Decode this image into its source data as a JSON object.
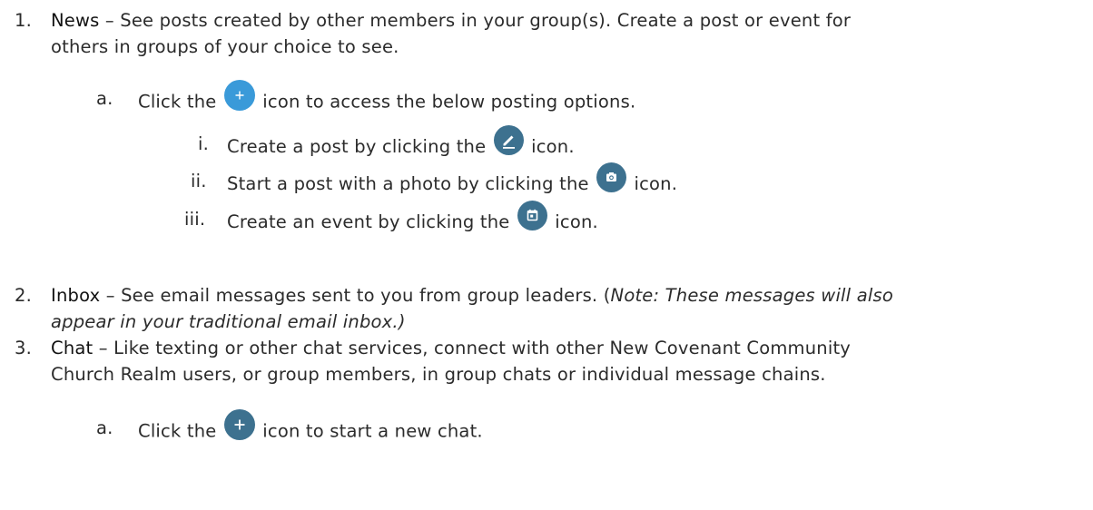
{
  "items": [
    {
      "number": "1.",
      "term": "News",
      "text_line1": " – See posts created by other members in your group(s). Create a post or event for",
      "text_line2": "others in groups of your choice to see.",
      "subitems": [
        {
          "marker": "a.",
          "before": "Click the",
          "after": "icon to access the below posting options.",
          "icon": "plus-icon",
          "subitems": [
            {
              "marker": "i.",
              "before": "Create a post by clicking the",
              "after": "icon.",
              "icon": "edit-icon"
            },
            {
              "marker": "ii.",
              "before": "Start a post with a photo by clicking the",
              "after": "icon.",
              "icon": "camera-icon"
            },
            {
              "marker": "iii.",
              "before": "Create an event by clicking the",
              "after": "icon.",
              "icon": "calendar-icon"
            }
          ]
        }
      ]
    },
    {
      "number": "2.",
      "term": "Inbox",
      "text_line1": " – See email messages sent to you from group leaders. (",
      "note_line1": "Note: These messages will also",
      "note_line2": "appear in your traditional email inbox.)"
    },
    {
      "number": "3.",
      "term": "Chat",
      "text_line1": " – Like texting or other chat services, connect with other New Covenant Community",
      "text_line2": "Church Realm users, or group members, in group chats or individual message chains.",
      "subitems": [
        {
          "marker": "a.",
          "before": "Click the",
          "after": "icon to start a new chat.",
          "icon": "plus-icon"
        }
      ]
    }
  ],
  "colors": {
    "text": "#2b2b2b",
    "icon_light_blue": "#3a9ad9",
    "icon_dark_blue": "#3d718f"
  }
}
